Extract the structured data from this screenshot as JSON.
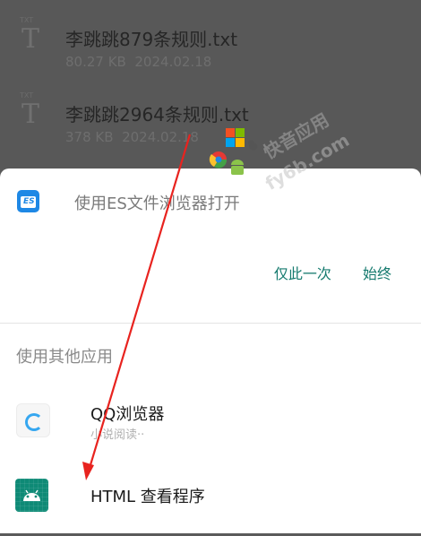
{
  "files": [
    {
      "name": "李跳跳879条规则.txt",
      "size": "80.27 KB",
      "date": "2024.02.18",
      "icon": "text-file-icon"
    },
    {
      "name": "李跳跳2964条规则.txt",
      "size": "378 KB",
      "date": "2024.02.18",
      "icon": "text-file-icon"
    }
  ],
  "file_icon_caption": "TXT",
  "sheet": {
    "default_app": {
      "label": "使用ES文件浏览器打开",
      "icon": "es-file-explorer-icon"
    },
    "actions": {
      "just_once": "仅此一次",
      "always": "始终"
    },
    "other_apps_title": "使用其他应用",
    "apps": [
      {
        "name": "QQ浏览器",
        "subtitle": "小说阅读··",
        "icon": "qq-browser-icon"
      },
      {
        "name": "HTML 查看程序",
        "icon": "android-app-icon"
      }
    ]
  },
  "watermark": {
    "text": "快音应用",
    "url": "fy6b.com"
  },
  "colors": {
    "accent": "#157a6e",
    "es_blue": "#1e88e5",
    "android_green": "#0e8a76",
    "arrow_red": "#e8231f"
  }
}
